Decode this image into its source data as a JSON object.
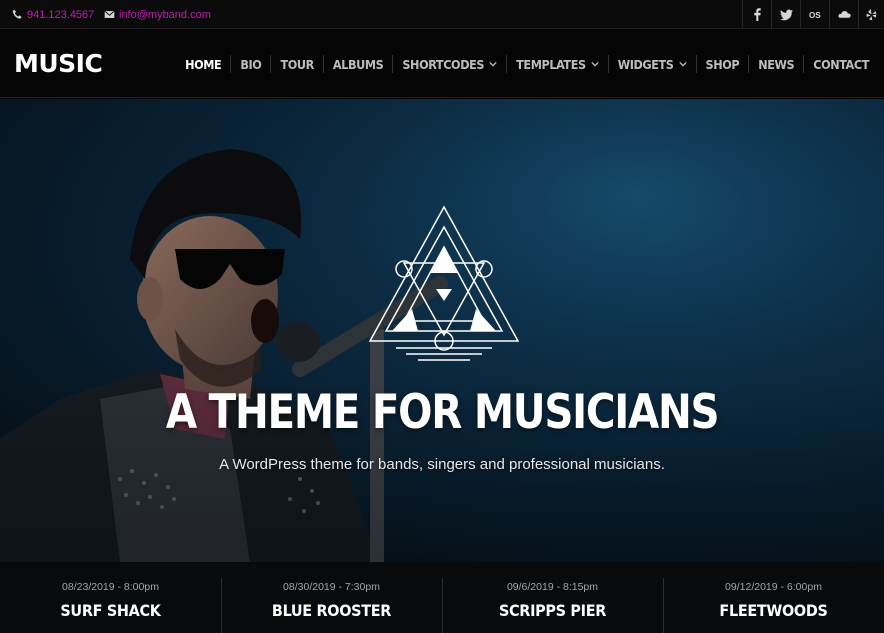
{
  "topbar": {
    "phone": "941.123.4567",
    "email": "info@myband.com",
    "socials": [
      "facebook-icon",
      "twitter-icon",
      "lastfm-icon",
      "soundcloud-icon",
      "yelp-icon"
    ]
  },
  "header": {
    "logo": "MUSIC",
    "nav": [
      {
        "label": "HOME",
        "dropdown": false
      },
      {
        "label": "BIO",
        "dropdown": false
      },
      {
        "label": "TOUR",
        "dropdown": false
      },
      {
        "label": "ALBUMS",
        "dropdown": false
      },
      {
        "label": "SHORTCODES",
        "dropdown": true
      },
      {
        "label": "TEMPLATES",
        "dropdown": true
      },
      {
        "label": "WIDGETS",
        "dropdown": true
      },
      {
        "label": "SHOP",
        "dropdown": false
      },
      {
        "label": "NEWS",
        "dropdown": false
      },
      {
        "label": "CONTACT",
        "dropdown": false
      }
    ]
  },
  "hero": {
    "title": "A THEME FOR MUSICIANS",
    "subtitle": "A WordPress theme for bands, singers and professional musicians."
  },
  "events": [
    {
      "date": "08/23/2019 - 8:00pm",
      "venue": "SURF SHACK"
    },
    {
      "date": "08/30/2019 - 7:30pm",
      "venue": "BLUE ROOSTER"
    },
    {
      "date": "09/6/2019 - 8:15pm",
      "venue": "SCRIPPS PIER"
    },
    {
      "date": "09/12/2019 - 6:00pm",
      "venue": "FLEETWOODS"
    }
  ],
  "colors": {
    "accent": "#c01db4",
    "background": "#000000",
    "hero_blue": "#0a2438"
  }
}
